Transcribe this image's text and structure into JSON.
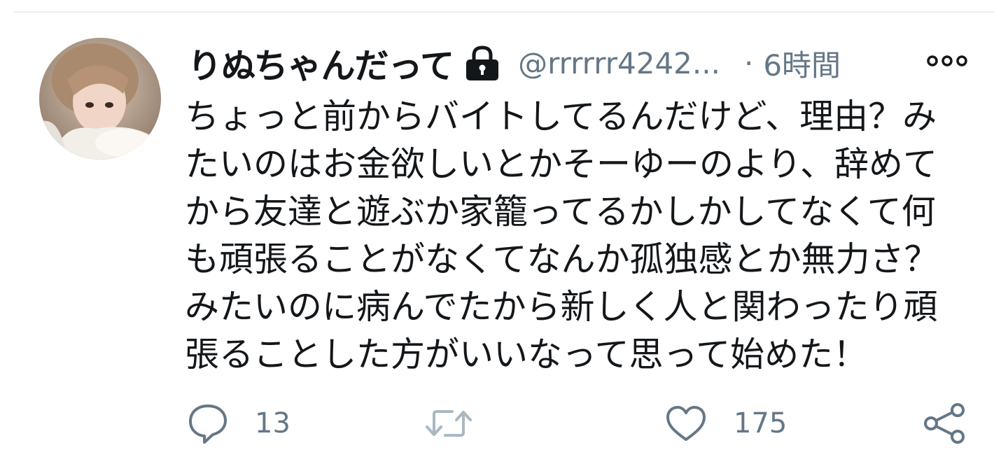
{
  "tweet": {
    "display_name": "りぬちゃんだって",
    "handle": "@rrrrrr4242...",
    "separator": "·",
    "time": "6時間",
    "protected_icon": "lock-icon",
    "text_lines": [
      "ちょっと前からバイトしてるんだけど、理由？み",
      "たいのはお金欲しいとかそーゆーのより、辞めて",
      "から友達と遊ぶか家籠ってるかしかしてなくて何",
      "も頑張ることがなくてなんか孤独感とか無力さ？",
      "みたいのに病んでたから新しく人と関わったり頑",
      "張ることした方がいいなって思って始めた！"
    ],
    "actions": {
      "reply": {
        "icon": "reply-icon",
        "count": "13"
      },
      "retweet": {
        "icon": "retweet-icon"
      },
      "like": {
        "icon": "heart-icon",
        "count": "175"
      },
      "share": {
        "icon": "share-icon"
      }
    }
  },
  "colors": {
    "text_primary": "#14171a",
    "text_secondary": "#657786",
    "retweet_disabled": "#aab8c2",
    "divider": "#eceff1"
  }
}
